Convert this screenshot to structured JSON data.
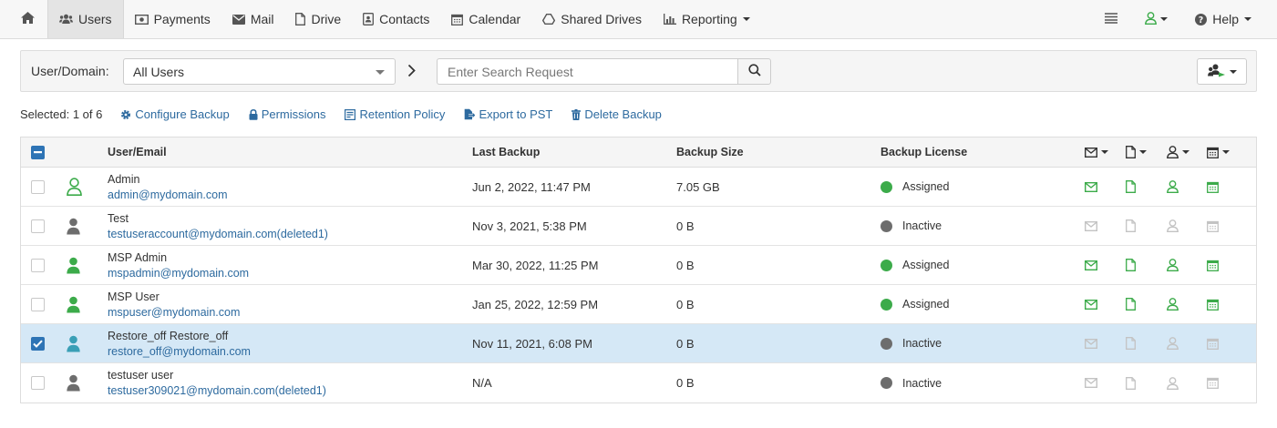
{
  "nav": {
    "items": [
      {
        "label": "Users",
        "icon": "users-icon"
      },
      {
        "label": "Payments",
        "icon": "money-icon"
      },
      {
        "label": "Mail",
        "icon": "envelope-icon"
      },
      {
        "label": "Drive",
        "icon": "file-icon"
      },
      {
        "label": "Contacts",
        "icon": "contact-card-icon"
      },
      {
        "label": "Calendar",
        "icon": "calendar-icon"
      },
      {
        "label": "Shared Drives",
        "icon": "google-drive-icon"
      },
      {
        "label": "Reporting",
        "icon": "bar-chart-icon"
      }
    ],
    "help_label": "Help"
  },
  "search": {
    "label": "User/Domain:",
    "domain_value": "All Users",
    "placeholder": "Enter Search Request"
  },
  "actions": {
    "selected_text": "Selected: 1 of 6",
    "configure_backup": "Configure Backup",
    "permissions": "Permissions",
    "retention_policy": "Retention Policy",
    "export_pst": "Export to PST",
    "delete_backup": "Delete Backup"
  },
  "table": {
    "columns": {
      "user": "User/Email",
      "last_backup": "Last Backup",
      "size": "Backup Size",
      "license": "Backup License"
    },
    "rows": [
      {
        "name": "Admin",
        "email": "admin@mydomain.com",
        "last_backup": "Jun 2, 2022, 11:47 PM",
        "size": "7.05 GB",
        "license": "Assigned",
        "status": "assigned",
        "avatar": "outline",
        "checked": false
      },
      {
        "name": "Test",
        "email": "testuseraccount@mydomain.com(deleted1)",
        "last_backup": "Nov 3, 2021, 5:38 PM",
        "size": "0 B",
        "license": "Inactive",
        "status": "inactive",
        "avatar": "gray",
        "checked": false
      },
      {
        "name": "MSP Admin",
        "email": "mspadmin@mydomain.com",
        "last_backup": "Mar 30, 2022, 11:25 PM",
        "size": "0 B",
        "license": "Assigned",
        "status": "assigned",
        "avatar": "green",
        "checked": false
      },
      {
        "name": "MSP User",
        "email": "mspuser@mydomain.com",
        "last_backup": "Jan 25, 2022, 12:59 PM",
        "size": "0 B",
        "license": "Assigned",
        "status": "assigned",
        "avatar": "green",
        "checked": false
      },
      {
        "name": "Restore_off Restore_off",
        "email": "restore_off@mydomain.com",
        "last_backup": "Nov 11, 2021, 6:08 PM",
        "size": "0 B",
        "license": "Inactive",
        "status": "inactive",
        "avatar": "teal",
        "checked": true
      },
      {
        "name": "testuser user",
        "email": "testuser309021@mydomain.com(deleted1)",
        "last_backup": "N/A",
        "size": "0 B",
        "license": "Inactive",
        "status": "inactive",
        "avatar": "gray",
        "checked": false
      }
    ]
  },
  "colors": {
    "accent": "#2d6a9f",
    "green": "#3cab4a",
    "gray_dot": "#6d6d6d",
    "selected_row": "#d5e8f6",
    "teal": "#3a9fb6"
  }
}
